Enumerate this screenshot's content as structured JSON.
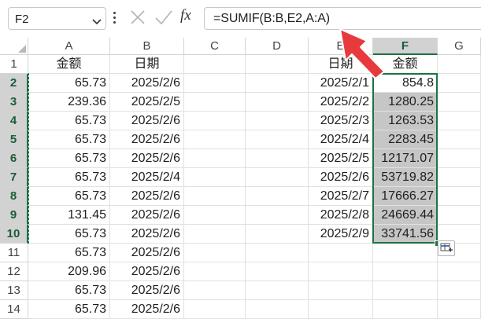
{
  "name_box": {
    "value": "F2"
  },
  "formula_bar": {
    "formula": "=SUMIF(B:B,E2,A:A)",
    "function_icon_label": "fx"
  },
  "columns": [
    "A",
    "B",
    "C",
    "D",
    "E",
    "F",
    "G"
  ],
  "selected_column": "F",
  "row_numbers": [
    "1",
    "2",
    "3",
    "4",
    "5",
    "6",
    "7",
    "8",
    "9",
    "10",
    "11",
    "12",
    "13",
    "14"
  ],
  "rows": [
    {
      "A": "金额",
      "B": "日期",
      "E": "日期",
      "F": "金额"
    },
    {
      "A": "65.73",
      "B": "2025/2/6",
      "E": "2025/2/1",
      "F": "854.8"
    },
    {
      "A": "239.36",
      "B": "2025/2/5",
      "E": "2025/2/2",
      "F": "1280.25"
    },
    {
      "A": "65.73",
      "B": "2025/2/6",
      "E": "2025/2/3",
      "F": "1263.53"
    },
    {
      "A": "65.73",
      "B": "2025/2/6",
      "E": "2025/2/4",
      "F": "2283.45"
    },
    {
      "A": "65.73",
      "B": "2025/2/6",
      "E": "2025/2/5",
      "F": "12171.07"
    },
    {
      "A": "65.73",
      "B": "2025/2/4",
      "E": "2025/2/6",
      "F": "53719.82"
    },
    {
      "A": "65.73",
      "B": "2025/2/6",
      "E": "2025/2/7",
      "F": "17666.27"
    },
    {
      "A": "131.45",
      "B": "2025/2/6",
      "E": "2025/2/8",
      "F": "24669.44"
    },
    {
      "A": "65.73",
      "B": "2025/2/6",
      "E": "2025/2/9",
      "F": "33741.56"
    },
    {
      "A": "65.73",
      "B": "2025/2/6",
      "E": "",
      "F": ""
    },
    {
      "A": "209.96",
      "B": "2025/2/6",
      "E": "",
      "F": ""
    },
    {
      "A": "65.73",
      "B": "2025/2/6",
      "E": "",
      "F": ""
    },
    {
      "A": "65.73",
      "B": "2025/2/6",
      "E": "",
      "F": ""
    }
  ],
  "colors": {
    "selection_green": "#1e7145",
    "selected_fill": "#c6c6c6",
    "annotation_arrow": "#e8393c"
  },
  "icons": {
    "cancel": "close-icon",
    "confirm": "checkmark-icon",
    "insert_function": "fx-icon",
    "quick_analysis": "quick-analysis-icon",
    "name_box_dropdown": "chevron-down-icon"
  }
}
